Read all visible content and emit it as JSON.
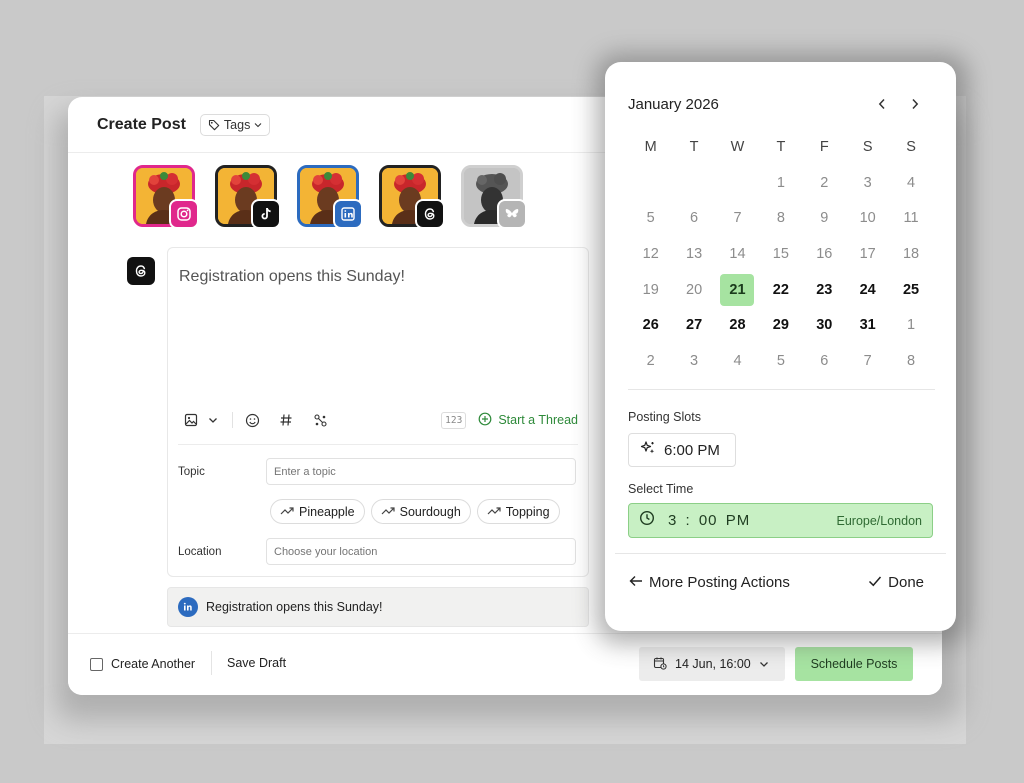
{
  "header": {
    "title": "Create Post",
    "tags_label": "Tags"
  },
  "accounts": [
    {
      "network": "instagram",
      "icon": "instagram-icon",
      "color": "#e0288c"
    },
    {
      "network": "tiktok",
      "icon": "tiktok-icon",
      "color": "#111111"
    },
    {
      "network": "linkedin",
      "icon": "linkedin-icon",
      "color": "#2c6bbf"
    },
    {
      "network": "threads",
      "icon": "threads-icon",
      "color": "#111111"
    },
    {
      "network": "bluesky",
      "icon": "bluesky-icon",
      "color": "#b5b5b5"
    }
  ],
  "editor": {
    "post_text": "Registration opens this Sunday!",
    "char_counter": "123",
    "start_thread_label": "Start a Thread",
    "topic_label": "Topic",
    "topic_placeholder": "Enter a topic",
    "topic_suggestions": [
      "Pineapple",
      "Sourdough",
      "Topping"
    ],
    "location_label": "Location",
    "location_placeholder": "Choose your location"
  },
  "linkedin_preview": {
    "text": "Registration opens this Sunday!"
  },
  "footer": {
    "create_another_label": "Create Another",
    "save_draft_label": "Save Draft",
    "date_value": "14 Jun, 16:00",
    "schedule_label": "Schedule Posts"
  },
  "calendar": {
    "month_label": "January 2026",
    "weekdays": [
      "M",
      "T",
      "W",
      "T",
      "F",
      "S",
      "S"
    ],
    "days": [
      {
        "d": "",
        "s": "blank"
      },
      {
        "d": "",
        "s": "blank"
      },
      {
        "d": "",
        "s": "blank"
      },
      {
        "d": "1",
        "s": "muted"
      },
      {
        "d": "2",
        "s": "muted"
      },
      {
        "d": "3",
        "s": "muted"
      },
      {
        "d": "4",
        "s": "muted"
      },
      {
        "d": "5",
        "s": "muted"
      },
      {
        "d": "6",
        "s": "muted"
      },
      {
        "d": "7",
        "s": "muted"
      },
      {
        "d": "8",
        "s": "muted"
      },
      {
        "d": "9",
        "s": "muted"
      },
      {
        "d": "10",
        "s": "muted"
      },
      {
        "d": "11",
        "s": "muted"
      },
      {
        "d": "12",
        "s": "muted"
      },
      {
        "d": "13",
        "s": "muted"
      },
      {
        "d": "14",
        "s": "muted"
      },
      {
        "d": "15",
        "s": "muted"
      },
      {
        "d": "16",
        "s": "muted"
      },
      {
        "d": "17",
        "s": "muted"
      },
      {
        "d": "18",
        "s": "muted"
      },
      {
        "d": "19",
        "s": "muted"
      },
      {
        "d": "20",
        "s": "muted"
      },
      {
        "d": "21",
        "s": "selected"
      },
      {
        "d": "22",
        "s": "bold"
      },
      {
        "d": "23",
        "s": "bold"
      },
      {
        "d": "24",
        "s": "bold"
      },
      {
        "d": "25",
        "s": "bold"
      },
      {
        "d": "26",
        "s": "bold"
      },
      {
        "d": "27",
        "s": "bold"
      },
      {
        "d": "28",
        "s": "bold"
      },
      {
        "d": "29",
        "s": "bold"
      },
      {
        "d": "30",
        "s": "bold"
      },
      {
        "d": "31",
        "s": "bold"
      },
      {
        "d": "1",
        "s": "muted"
      },
      {
        "d": "2",
        "s": "muted"
      },
      {
        "d": "3",
        "s": "muted"
      },
      {
        "d": "4",
        "s": "muted"
      },
      {
        "d": "5",
        "s": "muted"
      },
      {
        "d": "6",
        "s": "muted"
      },
      {
        "d": "7",
        "s": "muted"
      },
      {
        "d": "8",
        "s": "muted"
      }
    ],
    "posting_slots_label": "Posting Slots",
    "slot_time": "6:00 PM",
    "select_time_label": "Select Time",
    "time_value": "3 : 00  PM",
    "timezone": "Europe/London",
    "more_actions_label": "More Posting Actions",
    "done_label": "Done"
  },
  "colors": {
    "accent_green": "#a6e3a1",
    "instagram": "#e0288c",
    "linkedin": "#2c6bbf",
    "thread_link": "#2e8a3a"
  }
}
